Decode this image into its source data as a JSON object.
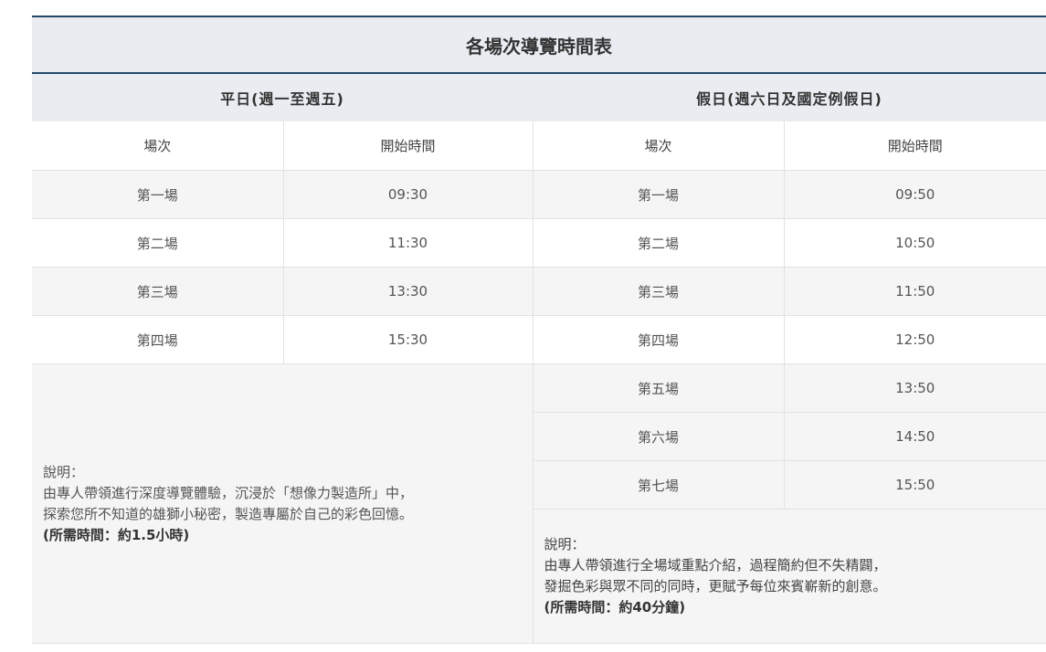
{
  "title": "各場次導覽時間表",
  "weekday": {
    "header": "平日(週一至週五)",
    "col_session": "場次",
    "col_time": "開始時間",
    "rows": [
      {
        "session": "第一場",
        "time": "09:30"
      },
      {
        "session": "第二場",
        "time": "11:30"
      },
      {
        "session": "第三場",
        "time": "13:30"
      },
      {
        "session": "第四場",
        "time": "15:30"
      }
    ],
    "note": {
      "label": "說明：",
      "line1": "由專人帶領進行深度導覽體驗，沉浸於「想像力製造所」中，",
      "line2": "探索您所不知道的雄獅小秘密，製造專屬於自己的彩色回憶。",
      "duration": "(所需時間：約1.5小時)"
    }
  },
  "holiday": {
    "header": "假日(週六日及國定例假日)",
    "col_session": "場次",
    "col_time": "開始時間",
    "rows": [
      {
        "session": "第一場",
        "time": "09:50"
      },
      {
        "session": "第二場",
        "time": "10:50"
      },
      {
        "session": "第三場",
        "time": "11:50"
      },
      {
        "session": "第四場",
        "time": "12:50"
      },
      {
        "session": "第五場",
        "time": "13:50"
      },
      {
        "session": "第六場",
        "time": "14:50"
      },
      {
        "session": "第七場",
        "time": "15:50"
      }
    ],
    "note": {
      "label": "說明：",
      "line1": "由專人帶領進行全場域重點介紹，過程簡約但不失精闢，",
      "line2": "發掘色彩與眾不同的同時，更賦予每位來賓嶄新的創意。",
      "duration": "(所需時間：約40分鐘)"
    }
  }
}
